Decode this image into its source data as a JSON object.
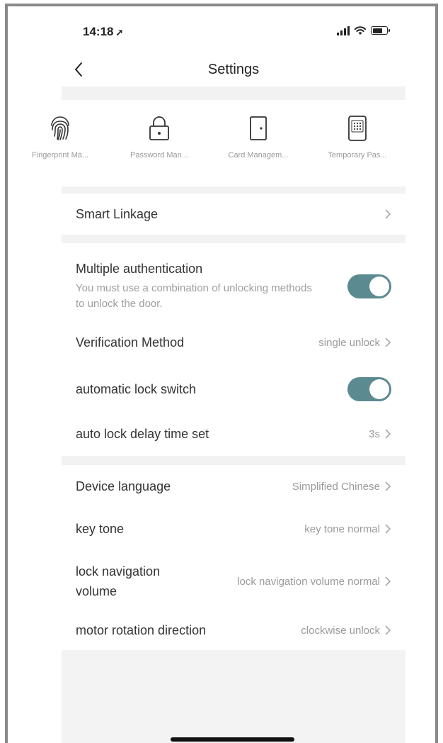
{
  "status_bar": {
    "time": "14:18",
    "location_arrow": "➚",
    "icons": [
      "signal-icon",
      "wifi-icon",
      "battery-icon"
    ]
  },
  "nav": {
    "title": "Settings",
    "back_icon": "chevron-left-icon"
  },
  "quick_functions": [
    {
      "label": "Fingerprint Ma...",
      "icon": "fingerprint-icon"
    },
    {
      "label": "Password Man...",
      "icon": "padlock-icon"
    },
    {
      "label": "Card Managem...",
      "icon": "door-icon"
    },
    {
      "label": "Temporary Pas...",
      "icon": "keypad-icon"
    }
  ],
  "smart_linkage": {
    "label": "Smart Linkage"
  },
  "multiple_auth": {
    "label": "Multiple authentication",
    "description": "You must use a combination of unlocking methods to unlock the door.",
    "enabled": true
  },
  "verification_method": {
    "label": "Verification Method",
    "value": "single unlock"
  },
  "automatic_lock": {
    "label": "automatic lock switch",
    "enabled": true
  },
  "auto_lock_delay": {
    "label": "auto lock delay time set",
    "value": "3s"
  },
  "device_language": {
    "label": "Device language",
    "value": "Simplified Chinese"
  },
  "key_tone": {
    "label": "key tone",
    "value": "key tone normal"
  },
  "lock_navigation": {
    "label": "lock navigation volume",
    "value": "lock navigation volume normal"
  },
  "motor_rotation": {
    "label": "motor rotation direction",
    "value": "clockwise unlock"
  },
  "colors": {
    "toggle_on": "#5c8a91",
    "section_gap": "#f2f2f2",
    "secondary_text": "#9a9a9a"
  }
}
